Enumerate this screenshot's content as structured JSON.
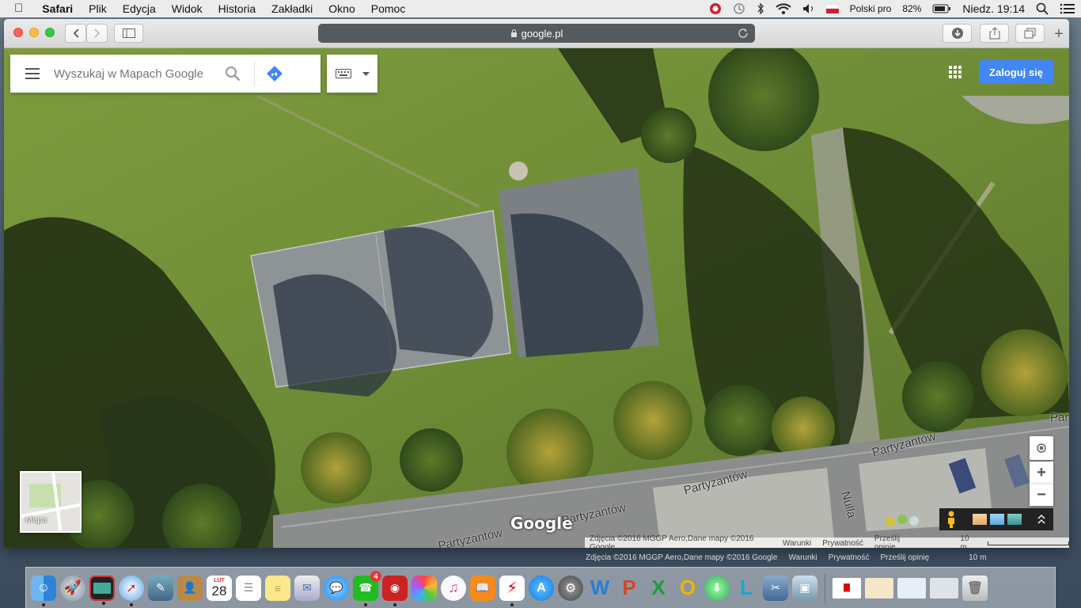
{
  "menubar": {
    "apple": "",
    "app": "Safari",
    "items": [
      "Plik",
      "Edycja",
      "Widok",
      "Historia",
      "Zakładki",
      "Okno",
      "Pomoc"
    ],
    "input_source": "Polski pro",
    "battery": "82%",
    "clock": "Niedz. 19:14"
  },
  "browser": {
    "url": "google.pl",
    "new_tab": "+"
  },
  "maps": {
    "search_placeholder": "Wyszukaj w Mapach Google",
    "login_label": "Zaloguj się",
    "minimap_label": "Mapa",
    "logo": "Google",
    "streets": [
      "Partyzantów",
      "Partyzantów",
      "Partyzantów",
      "Partyzantów",
      "Nulla",
      "Par"
    ],
    "zoom_in": "+",
    "zoom_out": "−",
    "attribution": {
      "imagery": "Zdjęcia ©2016 MGGP Aero,Dane mapy ©2016 Google",
      "terms": "Warunki",
      "privacy": "Prywatność",
      "feedback": "Prześlij opinię",
      "scale": "10 m"
    },
    "ghost_attribution": {
      "imagery": "Zdjęcia ©2016 MGGP Aero,Dane mapy ©2016 Google",
      "terms": "Warunki",
      "privacy": "Prywatność",
      "feedback": "Prześlij opinię",
      "scale": "10 m"
    }
  },
  "dock": {
    "calendar_month": "LUT",
    "calendar_day": "28",
    "facetime_badge": "4",
    "apps": [
      "finder",
      "launchpad",
      "photo-booth",
      "safari",
      "preview",
      "contacts",
      "calendar",
      "reminders",
      "notes",
      "mail-merge",
      "messages",
      "facetime",
      "photo-booth-2",
      "photos",
      "itunes",
      "ibooks",
      "acrobat",
      "app-store",
      "system-preferences",
      "word",
      "powerpoint",
      "excel",
      "outlook",
      "downloads",
      "lync",
      "finder-tools",
      "preview-2",
      "trash"
    ]
  }
}
